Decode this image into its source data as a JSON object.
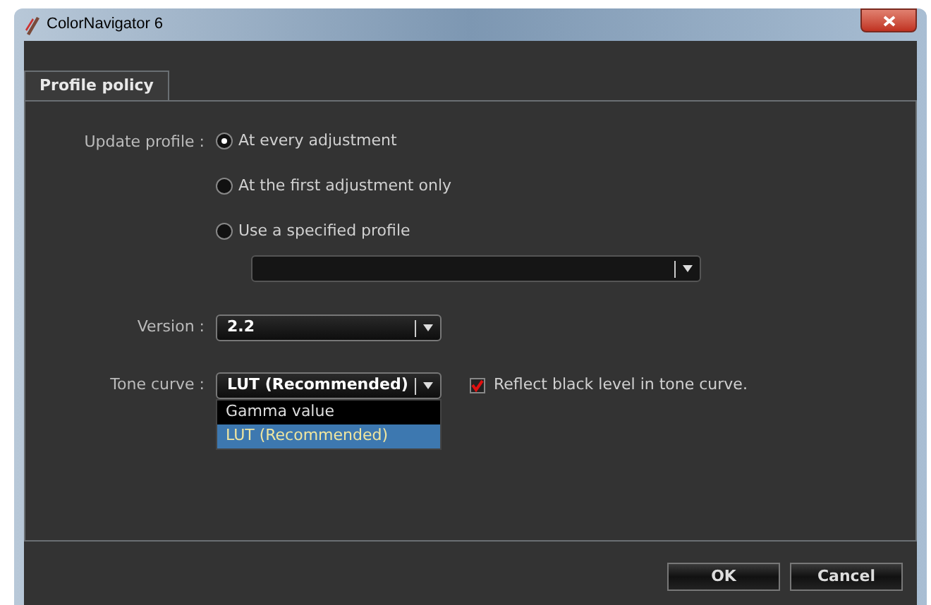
{
  "window": {
    "title": "ColorNavigator 6"
  },
  "tabs": [
    {
      "label": "Profile policy",
      "selected": true
    }
  ],
  "update_profile": {
    "label": "Update profile :",
    "options": [
      {
        "label": "At every adjustment",
        "selected": true
      },
      {
        "label": "At the first adjustment only",
        "selected": false
      },
      {
        "label": "Use a specified profile",
        "selected": false
      }
    ]
  },
  "version": {
    "label": "Version :",
    "value": "2.2"
  },
  "tone_curve": {
    "label": "Tone curve :",
    "value": "LUT (Recommended)",
    "expanded": true,
    "options": [
      {
        "label": "Gamma value",
        "selected": false
      },
      {
        "label": "LUT (Recommended)",
        "selected": true
      }
    ]
  },
  "reflect_black": {
    "label": "Reflect black level in tone curve.",
    "checked": true
  },
  "buttons": [
    "OK",
    "Cancel"
  ]
}
